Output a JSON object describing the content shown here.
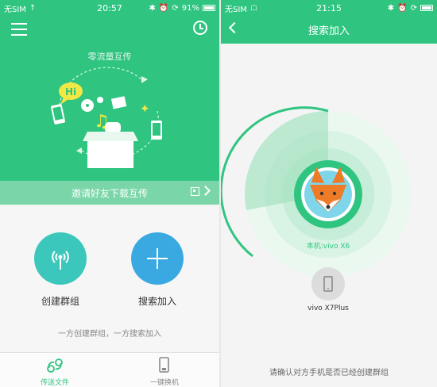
{
  "left": {
    "status_bar": {
      "carrier": "无SIM",
      "time": "20:57",
      "battery": "91%"
    },
    "hero": {
      "title": "零流量互传",
      "bubble_text": "Hi"
    },
    "invite_bar": {
      "text": "邀请好友下载互传"
    },
    "actions": {
      "create_group": "创建群组",
      "search_join": "搜索加入"
    },
    "hint": "一方创建群组，一方搜索加入",
    "tabs": [
      {
        "label": "传送文件",
        "active": true
      },
      {
        "label": "一键换机",
        "active": false
      }
    ]
  },
  "right": {
    "status_bar": {
      "carrier": "无SIM",
      "time": "21:15"
    },
    "header": {
      "title": "搜索加入"
    },
    "local_device": {
      "label": "本机:vivo X6"
    },
    "found_device": {
      "name": "vivo X7Plus"
    },
    "hint": "请确认对方手机是否已经创建群组"
  },
  "colors": {
    "brand_green": "#2fc581",
    "teal": "#3bc7bb",
    "blue": "#3aa9e1",
    "fox_orange": "#ee7b27"
  },
  "icons": [
    "menu-icon",
    "history-clock-icon",
    "qr-code-icon",
    "chevron-right-icon",
    "hotspot-icon",
    "plus-icon",
    "transfer-link-icon",
    "phone-switch-icon",
    "back-chevron-icon",
    "fox-avatar-icon",
    "phone-icon"
  ]
}
